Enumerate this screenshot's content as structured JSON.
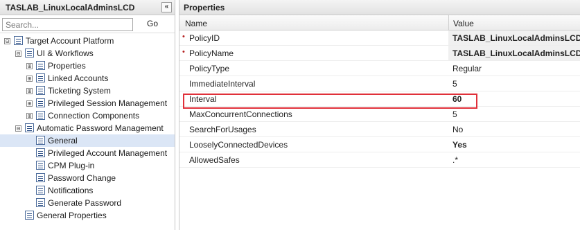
{
  "left_panel": {
    "title": "TASLAB_LinuxLocalAdminsLCD",
    "collapse_glyph": "«",
    "search_placeholder": "Search...",
    "go_label": "Go",
    "tree": [
      {
        "label": "Target Account Platform",
        "level": 0,
        "expander": "⊟",
        "selected": false
      },
      {
        "label": "UI & Workflows",
        "level": 1,
        "expander": "⊟",
        "selected": false
      },
      {
        "label": "Properties",
        "level": 2,
        "expander": "⊞",
        "selected": false
      },
      {
        "label": "Linked Accounts",
        "level": 2,
        "expander": "⊞",
        "selected": false
      },
      {
        "label": "Ticketing System",
        "level": 2,
        "expander": "⊞",
        "selected": false
      },
      {
        "label": "Privileged Session Management",
        "level": 2,
        "expander": "⊞",
        "selected": false
      },
      {
        "label": "Connection Components",
        "level": 2,
        "expander": "⊞",
        "selected": false
      },
      {
        "label": "Automatic Password Management",
        "level": 1,
        "expander": "⊟",
        "selected": false
      },
      {
        "label": "General",
        "level": 2,
        "expander": "",
        "selected": true
      },
      {
        "label": "Privileged Account Management",
        "level": 2,
        "expander": "",
        "selected": false
      },
      {
        "label": "CPM Plug-in",
        "level": 2,
        "expander": "",
        "selected": false
      },
      {
        "label": "Password Change",
        "level": 2,
        "expander": "",
        "selected": false
      },
      {
        "label": "Notifications",
        "level": 2,
        "expander": "",
        "selected": false
      },
      {
        "label": "Generate Password",
        "level": 2,
        "expander": "",
        "selected": false
      },
      {
        "label": "General Properties",
        "level": 1,
        "expander": "",
        "selected": false
      }
    ]
  },
  "right_panel": {
    "title": "Properties",
    "columns": {
      "name": "Name",
      "value": "Value"
    },
    "rows": [
      {
        "name": "PolicyID",
        "value": "TASLAB_LinuxLocalAdminsLCD",
        "required": true,
        "bold": true,
        "shaded": true
      },
      {
        "name": "PolicyName",
        "value": "TASLAB_LinuxLocalAdminsLCD",
        "required": true,
        "bold": true,
        "shaded": true
      },
      {
        "name": "PolicyType",
        "value": "Regular",
        "required": false,
        "bold": false,
        "shaded": false
      },
      {
        "name": "ImmediateInterval",
        "value": "5",
        "required": false,
        "bold": false,
        "shaded": false
      },
      {
        "name": "Interval",
        "value": "60",
        "required": false,
        "bold": true,
        "shaded": false
      },
      {
        "name": "MaxConcurrentConnections",
        "value": "5",
        "required": false,
        "bold": false,
        "shaded": false
      },
      {
        "name": "SearchForUsages",
        "value": "No",
        "required": false,
        "bold": false,
        "shaded": false
      },
      {
        "name": "LooselyConnectedDevices",
        "value": "Yes",
        "required": false,
        "bold": true,
        "shaded": false
      },
      {
        "name": "AllowedSafes",
        "value": ".*",
        "required": false,
        "bold": false,
        "shaded": false
      }
    ],
    "required_marker": "•",
    "highlight_color": "#e0303a"
  }
}
